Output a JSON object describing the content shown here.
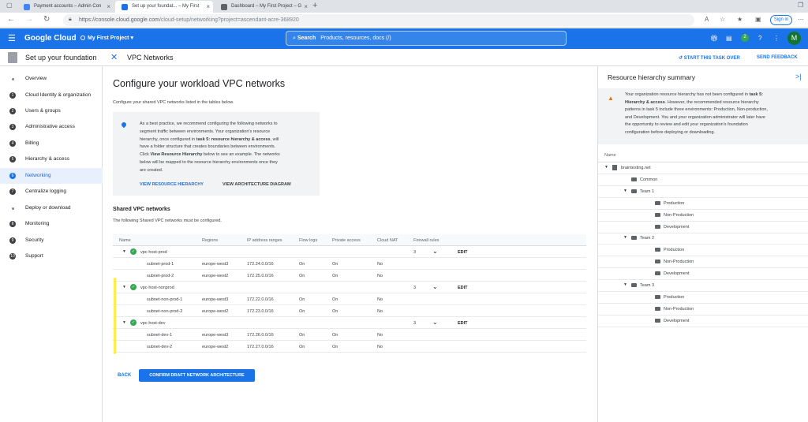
{
  "browser": {
    "tabs": [
      {
        "label": "Payment accounts – Admin Con",
        "active": false
      },
      {
        "label": "Set up your foundat... – My First",
        "active": true
      },
      {
        "label": "Dashboard – My First Project – G",
        "active": false
      }
    ],
    "url_host": "https://console.cloud.google.com",
    "url_path": "/cloud-setup/networking?project=ascendant-acre-368920",
    "sign_in": "Sign in"
  },
  "header": {
    "logo": "Google Cloud",
    "project": "My First Project",
    "search_label": "Search",
    "search_placeholder": "Products, resources, docs (/)",
    "notif_count": "2",
    "avatar_letter": "M",
    "brand_color": "#1a73e8"
  },
  "subheader": {
    "setup_title": "Set up your foundation",
    "page_title": "VPC Networks",
    "start_again": "START THIS TASK OVER",
    "feedback": "SEND FEEDBACK"
  },
  "sidebar": {
    "items": [
      {
        "num": "",
        "label": "Overview",
        "active": false
      },
      {
        "num": "1",
        "label": "Cloud Identity & organization",
        "active": false
      },
      {
        "num": "2",
        "label": "Users & groups",
        "active": false
      },
      {
        "num": "3",
        "label": "Administrative access",
        "active": false
      },
      {
        "num": "4",
        "label": "Billing",
        "active": false
      },
      {
        "num": "5",
        "label": "Hierarchy & access",
        "active": false
      },
      {
        "num": "6",
        "label": "Networking",
        "active": true
      },
      {
        "num": "7",
        "label": "Centralize logging",
        "active": false
      },
      {
        "num": "",
        "label": "Deploy or download",
        "active": false
      },
      {
        "num": "8",
        "label": "Monitoring",
        "active": false
      },
      {
        "num": "9",
        "label": "Security",
        "active": false
      },
      {
        "num": "10",
        "label": "Support",
        "active": false
      }
    ]
  },
  "main": {
    "heading": "Configure your workload VPC networks",
    "description": "Configure your shared VPC networks listed in the tables below.",
    "info_l1": "As a best practice, we recommend configuring the following networks to",
    "info_l2": "segment traffic between environments. Your organization's resource",
    "info_l3a": "hierarchy, once configured in ",
    "info_l3b": "task 5: resource hierarchy & access",
    "info_l3c": ", will",
    "info_l4": "have a folder structure that creates boundaries between environments.",
    "info_l5a": "Click ",
    "info_l5b": "View Resource Hierarchy",
    "info_l5c": " below to see an example. The networks",
    "info_l6": "below will be mapped to the resource hierarchy environments once they",
    "info_l7": "are created.",
    "view_hierarchy": "VIEW RESOURCE HIERARCHY",
    "view_arch": "VIEW ARCHITECTURE DIAGRAM",
    "shared_heading": "Shared VPC networks",
    "shared_desc": "The following Shared VPC networks must be configured.",
    "columns": [
      "Name",
      "Regions",
      "IP address ranges",
      "Flow logs",
      "Private access",
      "Cloud NAT",
      "Firewall rules"
    ],
    "rows": [
      {
        "kind": "net",
        "name": "vpc-host-prod",
        "firewall": "3",
        "edit": "EDIT"
      },
      {
        "kind": "sub",
        "name": "subnet-prod-1",
        "region": "europe-west3",
        "ip": "172.24.0.0/16",
        "flow": "On",
        "private": "On",
        "nat": "No"
      },
      {
        "kind": "sub",
        "name": "subnet-prod-2",
        "region": "europe-west2",
        "ip": "172.25.0.0/16",
        "flow": "On",
        "private": "On",
        "nat": "No"
      },
      {
        "kind": "net",
        "name": "vpc-host-nonprod",
        "firewall": "3",
        "edit": "EDIT"
      },
      {
        "kind": "sub",
        "name": "subnet-non-prod-1",
        "region": "europe-west3",
        "ip": "172.22.0.0/16",
        "flow": "On",
        "private": "On",
        "nat": "No"
      },
      {
        "kind": "sub",
        "name": "subnet-non-prod-2",
        "region": "europe-west2",
        "ip": "172.23.0.0/16",
        "flow": "On",
        "private": "On",
        "nat": "No"
      },
      {
        "kind": "net",
        "name": "vpc-host-dev",
        "firewall": "3",
        "edit": "EDIT"
      },
      {
        "kind": "sub",
        "name": "subnet-dev-1",
        "region": "europe-west3",
        "ip": "172.26.0.0/16",
        "flow": "On",
        "private": "On",
        "nat": "No"
      },
      {
        "kind": "sub",
        "name": "subnet-dev-2",
        "region": "europe-west2",
        "ip": "172.27.0.0/16",
        "flow": "On",
        "private": "On",
        "nat": "No"
      }
    ],
    "back": "BACK",
    "confirm": "CONFIRM DRAFT NETWORK ARCHITECTURE"
  },
  "panel": {
    "title": "Resource hierarchy summary",
    "warn_a": "Your organization resource hierarchy has not been configured in ",
    "warn_b": "task 5:",
    "warn_c": "Hierarchy & access",
    "warn_d": ". However, the recommended resource hierarchy",
    "warn_e": "patterns in task 5 include three environments: Production, Non-production,",
    "warn_f": "and Development. You and your organization administrator will later have",
    "warn_g": "the opportunity to review and edit your organization's foundation",
    "warn_h": "configuration before deploying or downloading.",
    "tree_header": "Name",
    "tree": [
      {
        "label": "braintesting.net",
        "level": 0,
        "type": "org",
        "expand": true
      },
      {
        "label": "Common",
        "level": 1,
        "type": "folder",
        "expand": false
      },
      {
        "label": "Team 1",
        "level": 1,
        "type": "folder",
        "expand": true
      },
      {
        "label": "Production",
        "level": 2,
        "type": "folder",
        "expand": false
      },
      {
        "label": "Non-Production",
        "level": 2,
        "type": "folder",
        "expand": false
      },
      {
        "label": "Development",
        "level": 2,
        "type": "folder",
        "expand": false
      },
      {
        "label": "Team 2",
        "level": 1,
        "type": "folder",
        "expand": true
      },
      {
        "label": "Production",
        "level": 2,
        "type": "folder",
        "expand": false
      },
      {
        "label": "Non-Production",
        "level": 2,
        "type": "folder",
        "expand": false
      },
      {
        "label": "Development",
        "level": 2,
        "type": "folder",
        "expand": false
      },
      {
        "label": "Team 3",
        "level": 1,
        "type": "folder",
        "expand": true
      },
      {
        "label": "Production",
        "level": 2,
        "type": "folder",
        "expand": false
      },
      {
        "label": "Non-Production",
        "level": 2,
        "type": "folder",
        "expand": false
      },
      {
        "label": "Development",
        "level": 2,
        "type": "folder",
        "expand": false
      }
    ]
  }
}
